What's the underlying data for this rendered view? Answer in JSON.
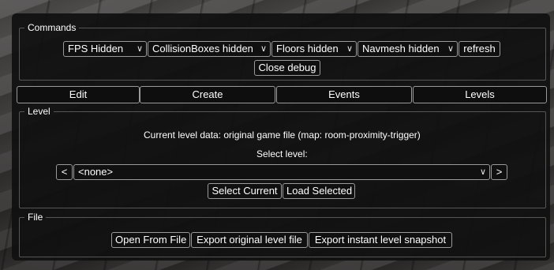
{
  "commands": {
    "legend": "Commands",
    "fps_select": "FPS Hidden",
    "collision_select": "CollisionBoxes hidden",
    "floors_select": "Floors hidden",
    "navmesh_select": "Navmesh hidden",
    "refresh": "refresh",
    "close_debug": "Close debug"
  },
  "tabs": [
    "Edit",
    "Create",
    "Events",
    "Levels"
  ],
  "level": {
    "legend": "Level",
    "current_info": "Current level data: original game file (map: room-proximity-trigger)",
    "select_label": "Select level:",
    "prev": "<",
    "next": ">",
    "selected": "<none>",
    "select_current": "Select Current",
    "load_selected": "Load Selected"
  },
  "file": {
    "legend": "File",
    "open": "Open From File",
    "export_original": "Export original level file",
    "export_snapshot": "Export instant level snapshot"
  },
  "icons": {
    "dropdown": "chevron-down-icon"
  }
}
